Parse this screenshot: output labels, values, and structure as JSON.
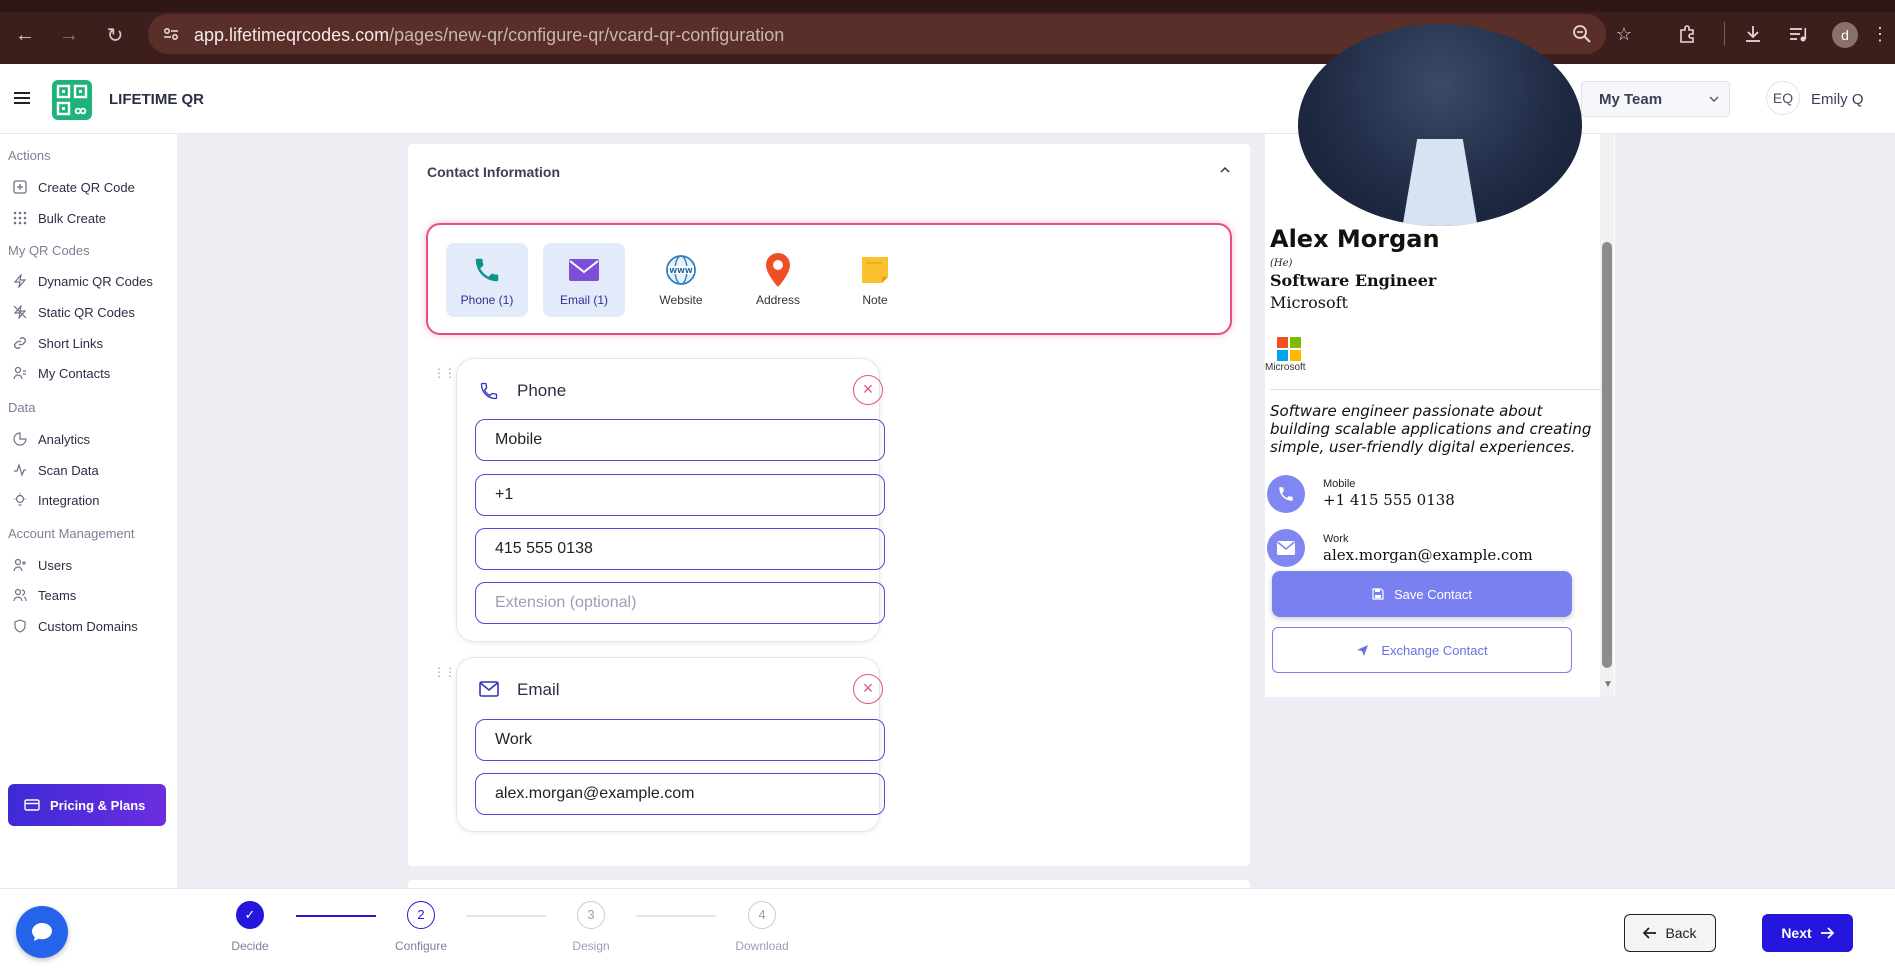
{
  "browser": {
    "url_host": "app.lifetimeqrcodes.com",
    "url_path": "/pages/new-qr/configure-qr/vcard-qr-configuration",
    "profile_initial": "d"
  },
  "header": {
    "brand": "LIFETIME QR",
    "team_select": "My Team",
    "user_initials": "EQ",
    "user_name": "Emily Q"
  },
  "sidebar": {
    "sections": [
      "Actions",
      "My QR Codes",
      "Data",
      "Account Management"
    ],
    "items": [
      {
        "label": "Create QR Code",
        "icon": "plus-square-icon"
      },
      {
        "label": "Bulk Create",
        "icon": "grid-icon"
      },
      {
        "label": "Dynamic QR Codes",
        "icon": "bolt-icon"
      },
      {
        "label": "Static QR Codes",
        "icon": "bolt-off-icon"
      },
      {
        "label": "Short Links",
        "icon": "link-icon"
      },
      {
        "label": "My Contacts",
        "icon": "contacts-icon"
      },
      {
        "label": "Analytics",
        "icon": "pie-chart-icon"
      },
      {
        "label": "Scan Data",
        "icon": "activity-icon"
      },
      {
        "label": "Integration",
        "icon": "lightbulb-icon"
      },
      {
        "label": "Users",
        "icon": "user-plus-icon"
      },
      {
        "label": "Teams",
        "icon": "users-icon"
      },
      {
        "label": "Custom Domains",
        "icon": "shield-icon"
      }
    ],
    "pricing_label": "Pricing & Plans"
  },
  "contact": {
    "section_title": "Contact Information",
    "types": [
      {
        "label": "Phone (1)",
        "icon": "phone-icon",
        "active": true
      },
      {
        "label": "Email (1)",
        "icon": "envelope-icon",
        "active": true
      },
      {
        "label": "Website",
        "icon": "www-globe-icon",
        "active": false
      },
      {
        "label": "Address",
        "icon": "map-pin-icon",
        "active": false
      },
      {
        "label": "Note",
        "icon": "sticky-note-icon",
        "active": false
      }
    ],
    "phone": {
      "title": "Phone",
      "label_value": "Mobile",
      "country_code": "+1",
      "number": "415 555 0138",
      "extension_placeholder": "Extension (optional)"
    },
    "email": {
      "title": "Email",
      "label_value": "Work",
      "address": "alex.morgan@example.com"
    }
  },
  "preview": {
    "name": "Alex Morgan",
    "pronouns": "(He)",
    "title": "Software Engineer",
    "company": "Microsoft",
    "logo_label": "Microsoft",
    "bio": "Software engineer passionate about building scalable applications and creating simple, user-friendly digital experiences.",
    "phone_label": "Mobile",
    "phone_value": "+1 415 555 0138",
    "email_label": "Work",
    "email_value": "alex.morgan@example.com",
    "save_label": "Save Contact",
    "exchange_label": "Exchange Contact"
  },
  "stepper": {
    "steps": [
      {
        "num": "✓",
        "label": "Decide"
      },
      {
        "num": "2",
        "label": "Configure"
      },
      {
        "num": "3",
        "label": "Design"
      },
      {
        "num": "4",
        "label": "Download"
      }
    ]
  },
  "footer": {
    "back_label": "Back",
    "next_label": "Next"
  },
  "colors": {
    "primary": "#2516de",
    "accent_preview": "#7b80f0",
    "danger": "#e0557f",
    "brand_green": "#1db37a"
  }
}
